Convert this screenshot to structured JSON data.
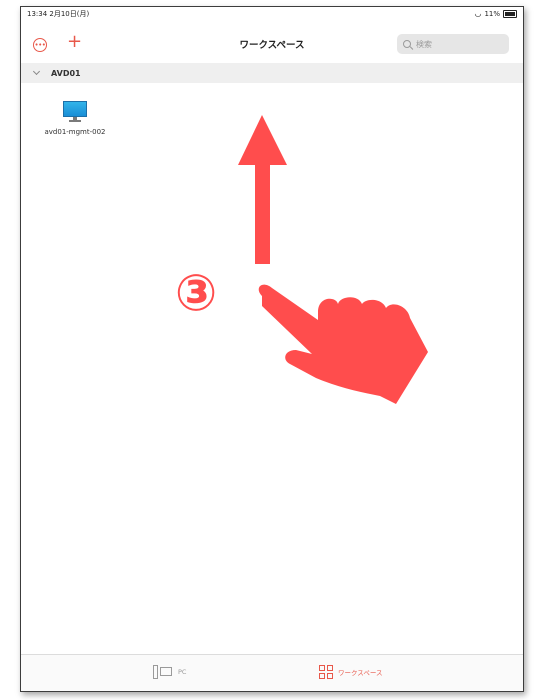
{
  "status_bar": {
    "time": "13:34 2月10日(月)",
    "wifi": "📶",
    "battery": "11%"
  },
  "nav": {
    "more_icon": "ellipsis-circle",
    "add_icon": "plus",
    "title": "ワークスペース",
    "search_placeholder": "検索"
  },
  "section": {
    "title": "AVD01"
  },
  "workspace_items": [
    {
      "label": "avd01-mgmt-002",
      "icon": "desktop-monitor"
    }
  ],
  "annotation": {
    "step": "③",
    "arrow": "up",
    "gesture": "swipe-up-hand",
    "color": "#ff4d4d"
  },
  "tabs": [
    {
      "label": "PC",
      "icon": "pc-icon",
      "active": false
    },
    {
      "label": "ワークスペース",
      "icon": "workspace-grid-icon",
      "active": true
    }
  ],
  "colors": {
    "accent": "#e8584a",
    "section_bg": "#efefef"
  }
}
